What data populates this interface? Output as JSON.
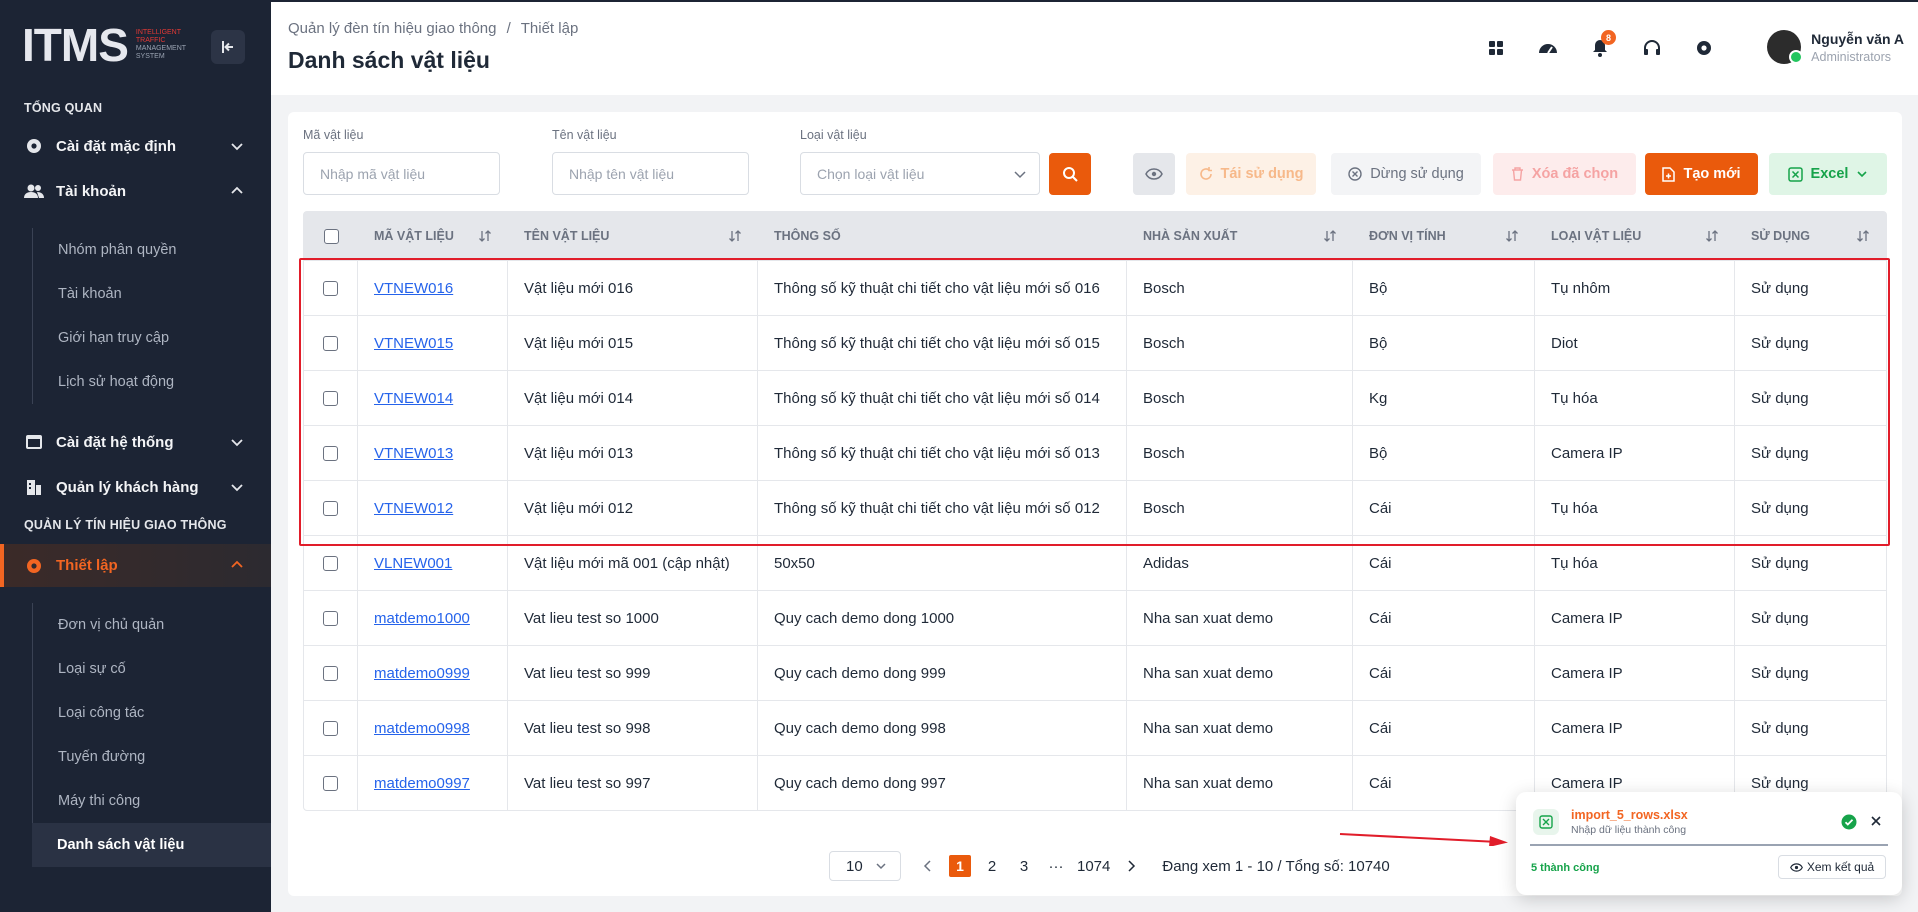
{
  "brand": {
    "logo_text": "ITMS",
    "tag_line1": "INTELLIGENT",
    "tag_line2": "TRAFFIC",
    "tag_line3": "MANAGEMENT",
    "tag_line4": "SYSTEM"
  },
  "sidebar": {
    "section_overview": "TỔNG QUAN",
    "default_settings": "Cài đặt mặc định",
    "account": "Tài khoản",
    "account_sub": [
      "Nhóm phân quyền",
      "Tài khoản",
      "Giới hạn truy cập",
      "Lịch sử hoạt động"
    ],
    "system_settings": "Cài đặt hệ thống",
    "customer_mgmt": "Quản lý khách hàng",
    "section_traffic": "QUẢN LÝ TÍN HIỆU GIAO THÔNG",
    "setup": "Thiết lập",
    "setup_sub": [
      "Đơn vị chủ quản",
      "Loại sự cố",
      "Loại công tác",
      "Tuyến đường",
      "Máy thi công",
      "Danh sách vật liệu"
    ]
  },
  "header": {
    "breadcrumb_root": "Quản lý đèn tín hiệu giao thông",
    "breadcrumb_sep": "/",
    "breadcrumb_current": "Thiết lập",
    "title": "Danh sách vật liệu",
    "notification_count": "8",
    "user_name": "Nguyễn văn A",
    "user_role": "Administrators"
  },
  "filters": {
    "code_label": "Mã vật liệu",
    "code_placeholder": "Nhập mã vật liệu",
    "name_label": "Tên vật liệu",
    "name_placeholder": "Nhập tên vật liệu",
    "type_label": "Loại vật liệu",
    "type_placeholder": "Chọn loại vật liệu"
  },
  "toolbar": {
    "reuse": "Tái sử dụng",
    "stop": "Dừng sử dụng",
    "delete_selected": "Xóa đã chọn",
    "create": "Tạo mới",
    "excel": "Excel"
  },
  "table": {
    "headers": [
      "MÃ VẬT LIỆU",
      "TÊN VẬT LIỆU",
      "THÔNG SỐ",
      "NHÀ SẢN XUẤT",
      "ĐƠN VỊ TÍNH",
      "LOẠI VẬT LIỆU",
      "SỬ DỤNG"
    ],
    "rows": [
      [
        "VTNEW016",
        "Vật liệu mới 016",
        "Thông số kỹ thuật chi tiết cho vật liệu mới số 016",
        "Bosch",
        "Bộ",
        "Tụ nhôm",
        "Sử dụng"
      ],
      [
        "VTNEW015",
        "Vật liệu mới 015",
        "Thông số kỹ thuật chi tiết cho vật liệu mới số 015",
        "Bosch",
        "Bộ",
        "Diot",
        "Sử dụng"
      ],
      [
        "VTNEW014",
        "Vật liệu mới 014",
        "Thông số kỹ thuật chi tiết cho vật liệu mới số 014",
        "Bosch",
        "Kg",
        "Tụ hóa",
        "Sử dụng"
      ],
      [
        "VTNEW013",
        "Vật liệu mới 013",
        "Thông số kỹ thuật chi tiết cho vật liệu mới số 013",
        "Bosch",
        "Bộ",
        "Camera IP",
        "Sử dụng"
      ],
      [
        "VTNEW012",
        "Vật liệu mới 012",
        "Thông số kỹ thuật chi tiết cho vật liệu mới số 012",
        "Bosch",
        "Cái",
        "Tụ hóa",
        "Sử dụng"
      ],
      [
        "VLNEW001",
        "Vật liệu mới mã 001 (cập nhật)",
        "50x50",
        "Adidas",
        "Cái",
        "Tụ hóa",
        "Sử dụng"
      ],
      [
        "matdemo1000",
        "Vat lieu test so 1000",
        "Quy cach demo dong 1000",
        "Nha san xuat demo",
        "Cái",
        "Camera IP",
        "Sử dụng"
      ],
      [
        "matdemo0999",
        "Vat lieu test so 999",
        "Quy cach demo dong 999",
        "Nha san xuat demo",
        "Cái",
        "Camera IP",
        "Sử dụng"
      ],
      [
        "matdemo0998",
        "Vat lieu test so 998",
        "Quy cach demo dong 998",
        "Nha san xuat demo",
        "Cái",
        "Camera IP",
        "Sử dụng"
      ],
      [
        "matdemo0997",
        "Vat lieu test so 997",
        "Quy cach demo dong 997",
        "Nha san xuat demo",
        "Cái",
        "Camera IP",
        "Sử dụng"
      ]
    ]
  },
  "pagination": {
    "page_size": "10",
    "pages": [
      "1",
      "2",
      "3"
    ],
    "ellipsis": "···",
    "last_page": "1074",
    "info": "Đang xem 1 - 10 / Tổng số: 10740"
  },
  "toast": {
    "file_name": "import_5_rows.xlsx",
    "subtitle": "Nhập dữ liệu thành công",
    "count": "5 thành công",
    "view_result": "Xem kết quả"
  },
  "colors": {
    "accent": "#ea5a0c",
    "sidebar_bg": "#1c2434",
    "link": "#2563eb",
    "success": "#16a34a",
    "highlight": "#e11d2a"
  }
}
